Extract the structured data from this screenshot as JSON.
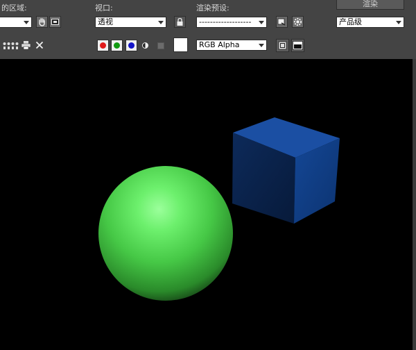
{
  "toolbar": {
    "area_label": "的区域:",
    "area_value": "",
    "viewport_label": "视口:",
    "viewport_value": "透视",
    "preset_label": "渲染预设:",
    "preset_value": "-------------------",
    "render_button": "渲染",
    "quality_value": "产品级",
    "channel_value": "RGB Alpha"
  },
  "colors": {
    "red_channel": "#e11b1b",
    "green_channel": "#129a12",
    "blue_channel": "#1414c8",
    "swatch": "#ffffff",
    "sphere": "#4ed24e",
    "cube": "#0f3b7e"
  },
  "icons": {
    "hand": "hand-icon",
    "region_select": "region-select-icon",
    "lock": "lock-icon",
    "preset_save": "preset-save-icon",
    "gear": "gear-icon",
    "copy_a": "copy-image-icon",
    "copy_b": "clone-window-icon",
    "print": "print-icon",
    "clear": "close-icon",
    "mono": "mono-display-icon",
    "alpha_toggle": "alpha-toggle-icon",
    "history_a": "render-history-icon",
    "history_b": "display-frame-icon"
  }
}
